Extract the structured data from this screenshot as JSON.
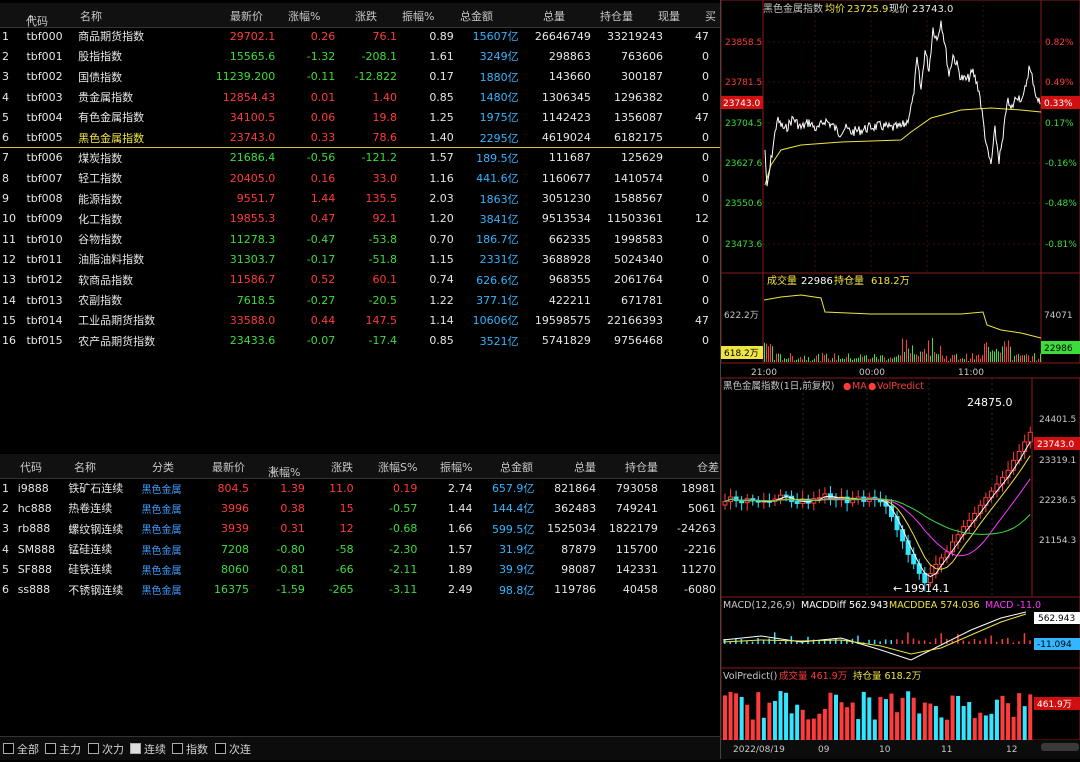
{
  "top_table": {
    "headers": [
      "代码",
      "名称",
      "最新价",
      "涨幅%",
      "涨跌",
      "振幅%",
      "总金额",
      "总量",
      "持仓量",
      "现量",
      "买"
    ],
    "rows": [
      {
        "n": "1",
        "code": "tbf000",
        "name": "商品期货指数",
        "price": "29702.1",
        "chg_pct": "0.26",
        "chg": "76.1",
        "amp": "0.89",
        "amount": "15607亿",
        "vol": "26646749",
        "oi": "33219243",
        "cur": "47",
        "dir": "up"
      },
      {
        "n": "2",
        "code": "tbf001",
        "name": "股指指数",
        "price": "15565.6",
        "chg_pct": "-1.32",
        "chg": "-208.1",
        "amp": "1.61",
        "amount": "3249亿",
        "vol": "298863",
        "oi": "763606",
        "cur": "0",
        "dir": "down"
      },
      {
        "n": "3",
        "code": "tbf002",
        "name": "国债指数",
        "price": "11239.200",
        "chg_pct": "-0.11",
        "chg": "-12.822",
        "amp": "0.17",
        "amount": "1880亿",
        "vol": "143660",
        "oi": "300187",
        "cur": "0",
        "dir": "down"
      },
      {
        "n": "4",
        "code": "tbf003",
        "name": "贵金属指数",
        "price": "12854.43",
        "chg_pct": "0.01",
        "chg": "1.40",
        "amp": "0.85",
        "amount": "1480亿",
        "vol": "1306345",
        "oi": "1296382",
        "cur": "0",
        "dir": "up"
      },
      {
        "n": "5",
        "code": "tbf004",
        "name": "有色金属指数",
        "price": "34100.5",
        "chg_pct": "0.06",
        "chg": "19.8",
        "amp": "1.25",
        "amount": "1975亿",
        "vol": "1142423",
        "oi": "1356087",
        "cur": "47",
        "dir": "up"
      },
      {
        "n": "6",
        "code": "tbf005",
        "name": "黑色金属指数",
        "price": "23743.0",
        "chg_pct": "0.33",
        "chg": "78.6",
        "amp": "1.40",
        "amount": "2295亿",
        "vol": "4619024",
        "oi": "6182175",
        "cur": "0",
        "dir": "up"
      },
      {
        "n": "7",
        "code": "tbf006",
        "name": "煤炭指数",
        "price": "21686.4",
        "chg_pct": "-0.56",
        "chg": "-121.2",
        "amp": "1.57",
        "amount": "189.5亿",
        "vol": "111687",
        "oi": "125629",
        "cur": "0",
        "dir": "down"
      },
      {
        "n": "8",
        "code": "tbf007",
        "name": "轻工指数",
        "price": "20405.0",
        "chg_pct": "0.16",
        "chg": "33.0",
        "amp": "1.16",
        "amount": "441.6亿",
        "vol": "1160677",
        "oi": "1410574",
        "cur": "0",
        "dir": "up"
      },
      {
        "n": "9",
        "code": "tbf008",
        "name": "能源指数",
        "price": "9551.7",
        "chg_pct": "1.44",
        "chg": "135.5",
        "amp": "2.03",
        "amount": "1863亿",
        "vol": "3051230",
        "oi": "1588567",
        "cur": "0",
        "dir": "up"
      },
      {
        "n": "10",
        "code": "tbf009",
        "name": "化工指数",
        "price": "19855.3",
        "chg_pct": "0.47",
        "chg": "92.1",
        "amp": "1.20",
        "amount": "3841亿",
        "vol": "9513534",
        "oi": "11503361",
        "cur": "12",
        "dir": "up"
      },
      {
        "n": "11",
        "code": "tbf010",
        "name": "谷物指数",
        "price": "11278.3",
        "chg_pct": "-0.47",
        "chg": "-53.8",
        "amp": "0.70",
        "amount": "186.7亿",
        "vol": "662335",
        "oi": "1998583",
        "cur": "0",
        "dir": "down"
      },
      {
        "n": "12",
        "code": "tbf011",
        "name": "油脂油料指数",
        "price": "31303.7",
        "chg_pct": "-0.17",
        "chg": "-51.8",
        "amp": "1.15",
        "amount": "2331亿",
        "vol": "3688928",
        "oi": "5024340",
        "cur": "0",
        "dir": "down"
      },
      {
        "n": "13",
        "code": "tbf012",
        "name": "软商品指数",
        "price": "11586.7",
        "chg_pct": "0.52",
        "chg": "60.1",
        "amp": "0.74",
        "amount": "626.6亿",
        "vol": "968355",
        "oi": "2061764",
        "cur": "0",
        "dir": "up"
      },
      {
        "n": "14",
        "code": "tbf013",
        "name": "农副指数",
        "price": "7618.5",
        "chg_pct": "-0.27",
        "chg": "-20.5",
        "amp": "1.22",
        "amount": "377.1亿",
        "vol": "422211",
        "oi": "671781",
        "cur": "0",
        "dir": "down"
      },
      {
        "n": "15",
        "code": "tbf014",
        "name": "工业品期货指数",
        "price": "33588.0",
        "chg_pct": "0.44",
        "chg": "147.5",
        "amp": "1.14",
        "amount": "10606亿",
        "vol": "19598575",
        "oi": "22166393",
        "cur": "47",
        "dir": "up"
      },
      {
        "n": "16",
        "code": "tbf015",
        "name": "农产品期货指数",
        "price": "23433.6",
        "chg_pct": "-0.07",
        "chg": "-17.4",
        "amp": "0.85",
        "amount": "3521亿",
        "vol": "5741829",
        "oi": "9756468",
        "cur": "0",
        "dir": "down"
      }
    ]
  },
  "bottom_table": {
    "headers": [
      "代码",
      "名称",
      "分类",
      "最新价",
      "涨幅%",
      "涨跌",
      "涨幅S%",
      "振幅%",
      "总金额",
      "总量",
      "持仓量",
      "仓差"
    ],
    "rows": [
      {
        "n": "1",
        "code": "i9888",
        "name": "铁矿石连续",
        "cat": "黑色金属",
        "price": "804.5",
        "chg_pct": "1.39",
        "chg": "11.0",
        "chg_s": "0.19",
        "amp": "2.74",
        "amount": "657.9亿",
        "vol": "821864",
        "oi": "793058",
        "diff": "18981",
        "dir": "up",
        "sdir": "up"
      },
      {
        "n": "2",
        "code": "hc888",
        "name": "热卷连续",
        "cat": "黑色金属",
        "price": "3996",
        "chg_pct": "0.38",
        "chg": "15",
        "chg_s": "-0.57",
        "amp": "1.44",
        "amount": "144.4亿",
        "vol": "362483",
        "oi": "749241",
        "diff": "5061",
        "dir": "up",
        "sdir": "down"
      },
      {
        "n": "3",
        "code": "rb888",
        "name": "螺纹钢连续",
        "cat": "黑色金属",
        "price": "3939",
        "chg_pct": "0.31",
        "chg": "12",
        "chg_s": "-0.68",
        "amp": "1.66",
        "amount": "599.5亿",
        "vol": "1525034",
        "oi": "1822179",
        "diff": "-24263",
        "dir": "up",
        "sdir": "down"
      },
      {
        "n": "4",
        "code": "SM888",
        "name": "锰硅连续",
        "cat": "黑色金属",
        "price": "7208",
        "chg_pct": "-0.80",
        "chg": "-58",
        "chg_s": "-2.30",
        "amp": "1.57",
        "amount": "31.9亿",
        "vol": "87879",
        "oi": "115700",
        "diff": "-2216",
        "dir": "down",
        "sdir": "down"
      },
      {
        "n": "5",
        "code": "SF888",
        "name": "硅铁连续",
        "cat": "黑色金属",
        "price": "8060",
        "chg_pct": "-0.81",
        "chg": "-66",
        "chg_s": "-2.11",
        "amp": "1.89",
        "amount": "39.9亿",
        "vol": "98087",
        "oi": "142331",
        "diff": "11270",
        "dir": "down",
        "sdir": "down"
      },
      {
        "n": "6",
        "code": "ss888",
        "name": "不锈钢连续",
        "cat": "黑色金属",
        "price": "16375",
        "chg_pct": "-1.59",
        "chg": "-265",
        "chg_s": "-3.11",
        "amp": "2.49",
        "amount": "98.8亿",
        "vol": "119786",
        "oi": "40458",
        "diff": "-6080",
        "dir": "down",
        "sdir": "down"
      }
    ]
  },
  "filter_bar": {
    "items": [
      {
        "label": "全部",
        "checked": false
      },
      {
        "label": "主力",
        "checked": false
      },
      {
        "label": "次力",
        "checked": false
      },
      {
        "label": "连续",
        "checked": true
      },
      {
        "label": "指数",
        "checked": false
      },
      {
        "label": "次连",
        "checked": false
      }
    ]
  },
  "intraday": {
    "title": "黑色金属指数",
    "avg_label": "均价",
    "avg_value": "23725.9",
    "cur_label": "现价",
    "cur_value": "23743.0",
    "price_ticks": [
      "23858.5",
      "23781.5",
      "23743.0",
      "23704.5",
      "23627.6",
      "23550.6",
      "23473.6"
    ],
    "pct_ticks": [
      "0.82%",
      "0.49%",
      "0.33%",
      "0.17%",
      "-0.16%",
      "-0.48%",
      "-0.81%"
    ],
    "vol_label": "成交量",
    "vol_value": "22986",
    "oi_label": "持仓量",
    "oi_value": "618.2万",
    "vol_left_ticks": [
      "622.2万",
      "618.2万"
    ],
    "vol_right_ticks": [
      "74071",
      "22986"
    ],
    "time_ticks": [
      "21:00",
      "00:00",
      "11:00"
    ],
    "colors": {
      "price": "#ffffff",
      "avg": "#f0e442",
      "up": "#ff3b3b",
      "down": "#3ddc3d"
    }
  },
  "kline": {
    "title": "黑色金属指数(1日,前复权)",
    "ma_label": "MA",
    "volpredict_label": "VolPredict",
    "high_label": "24875.0",
    "low_label": "19914.1",
    "price_ticks": [
      "24401.5",
      "23743.0",
      "23319.1",
      "22236.5",
      "21154.3"
    ],
    "macd_label": "MACD(12,26,9)",
    "macd_diff": "MACDDiff 562.943",
    "macd_dea": "MACDDEA 574.036",
    "macd_val": "MACD -11.0",
    "macd_ticks": [
      "562.943",
      "-11.094"
    ],
    "vp_label": "VolPredict()",
    "vp_vol": "成交量 461.9万",
    "vp_oi": "持仓量 618.2万",
    "vp_tick": "461.9万",
    "date_start": "2022/08/19",
    "month_ticks": [
      "09",
      "10",
      "11",
      "12"
    ],
    "colors": {
      "up": "#ff3b3b",
      "down": "#33e5ff",
      "ma1": "#ffffff",
      "ma2": "#f0e442",
      "ma3": "#ff33ff",
      "ma4": "#3ddc3d"
    }
  }
}
